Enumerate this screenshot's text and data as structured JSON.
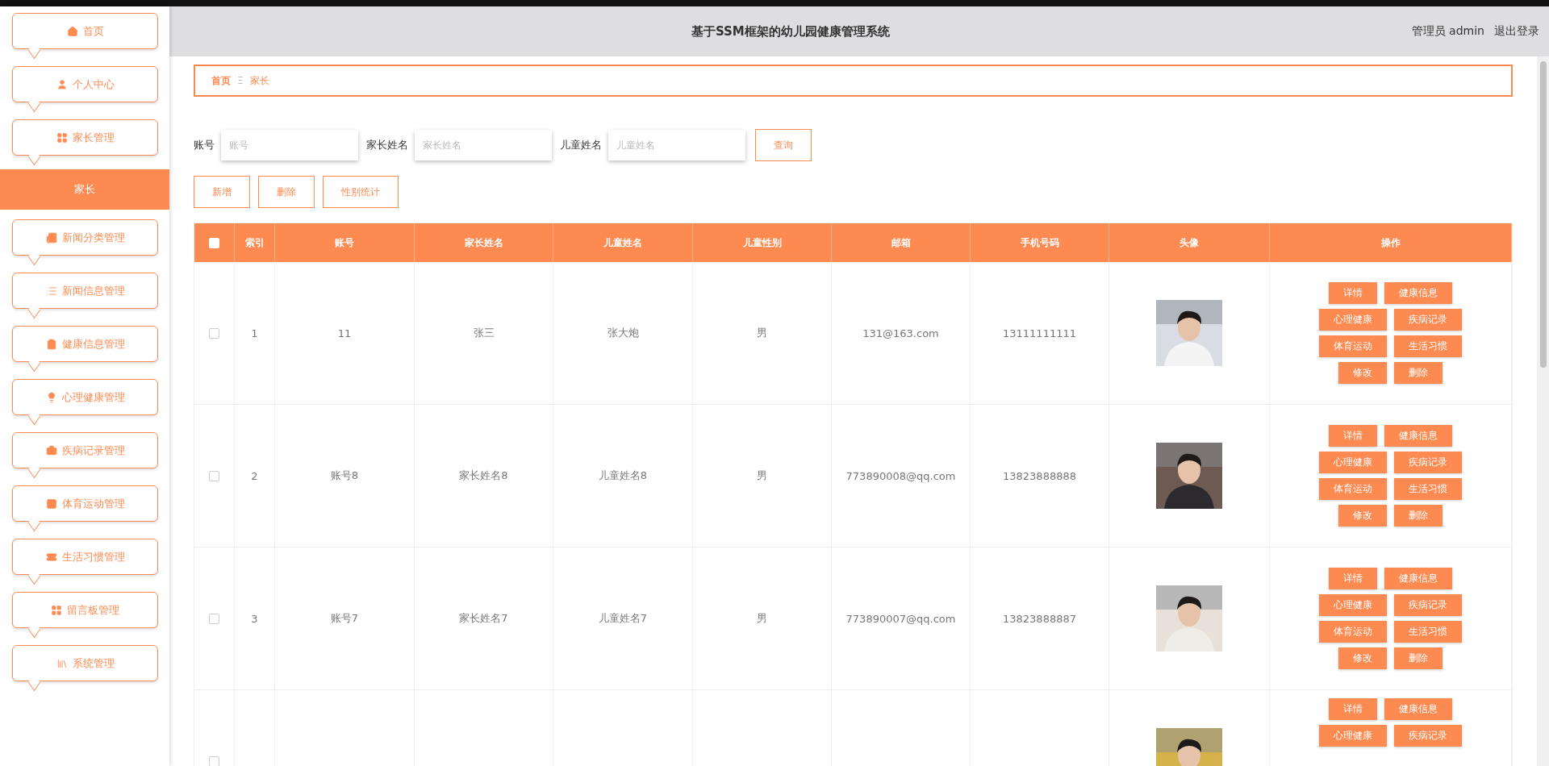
{
  "header": {
    "title": "基于SSM框架的幼儿园健康管理系统",
    "user": "管理员 admin",
    "logout": "退出登录"
  },
  "sidebar": {
    "items": [
      {
        "label": "首页",
        "selected": false
      },
      {
        "label": "个人中心",
        "selected": false
      },
      {
        "label": "家长管理",
        "selected": false,
        "children": [
          {
            "label": "家长",
            "selected": true
          }
        ]
      },
      {
        "label": "新闻分类管理",
        "selected": false
      },
      {
        "label": "新闻信息管理",
        "selected": false
      },
      {
        "label": "健康信息管理",
        "selected": false
      },
      {
        "label": "心理健康管理",
        "selected": false
      },
      {
        "label": "疾病记录管理",
        "selected": false
      },
      {
        "label": "体育运动管理",
        "selected": false
      },
      {
        "label": "生活习惯管理",
        "selected": false
      },
      {
        "label": "留言板管理",
        "selected": false
      },
      {
        "label": "系统管理",
        "selected": false
      }
    ]
  },
  "breadcrumb": {
    "home": "首页",
    "separator": "Ξ",
    "current": "家长"
  },
  "search": {
    "fields": [
      {
        "label": "账号",
        "placeholder": "账号"
      },
      {
        "label": "家长姓名",
        "placeholder": "家长姓名"
      },
      {
        "label": "儿童姓名",
        "placeholder": "儿童姓名"
      }
    ],
    "button": "查询"
  },
  "toolbar": [
    "新增",
    "删除",
    "性别统计"
  ],
  "table": {
    "all_checked": false,
    "columns": [
      "索引",
      "账号",
      "家长姓名",
      "儿童姓名",
      "儿童性别",
      "邮箱",
      "手机号码",
      "头像",
      "操作"
    ],
    "rows": [
      {
        "checked": false,
        "cells": [
          "1",
          "11",
          "张三",
          "张大炮",
          "男",
          "131@163.com",
          "13111111111"
        ],
        "avatar": {
          "kind": "picture"
        },
        "actions": [
          "详情",
          "健康信息",
          "心理健康",
          "疾病记录",
          "体育运动",
          "生活习惯",
          "修改",
          "删除"
        ]
      },
      {
        "checked": false,
        "cells": [
          "2",
          "账号8",
          "家长姓名8",
          "儿童姓名8",
          "男",
          "773890008@qq.com",
          "13823888888"
        ],
        "avatar": {
          "kind": "picture"
        },
        "actions": [
          "详情",
          "健康信息",
          "心理健康",
          "疾病记录",
          "体育运动",
          "生活习惯",
          "修改",
          "删除"
        ]
      },
      {
        "checked": false,
        "cells": [
          "3",
          "账号7",
          "家长姓名7",
          "儿童姓名7",
          "男",
          "773890007@qq.com",
          "13823888887"
        ],
        "avatar": {
          "kind": "picture"
        },
        "actions": [
          "详情",
          "健康信息",
          "心理健康",
          "疾病记录",
          "体育运动",
          "生活习惯",
          "修改",
          "删除"
        ]
      },
      {
        "checked": false,
        "cells": [],
        "avatar": {
          "kind": "picture"
        },
        "actions": [
          "详情",
          "健康信息",
          "心理健康",
          "疾病记录"
        ]
      }
    ]
  }
}
